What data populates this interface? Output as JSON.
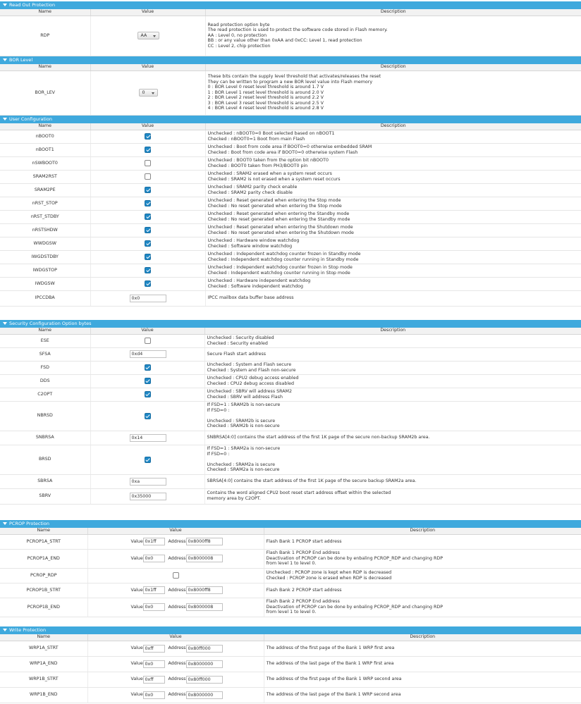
{
  "headers": {
    "name": "Name",
    "value": "Value",
    "description": "Description"
  },
  "value_label": "Value",
  "address_label": "Address",
  "sections": {
    "rop": {
      "title": "Read Out Protection",
      "rows": [
        {
          "name": "RDP",
          "select": "AA",
          "desc": [
            "Read protection option byte",
            "The read protection is used to protect the software code stored in Flash memory.",
            "AA : Level 0, no protection",
            "BB : or any value other than 0xAA and 0xCC: Level 1, read protection",
            "CC : Level 2, chip protection"
          ]
        }
      ]
    },
    "bor": {
      "title": "BOR Level",
      "rows": [
        {
          "name": "BOR_LEV",
          "select": "0",
          "desc": [
            "These bits contain the supply level threshold that activates/releases the reset",
            "They can be written to program a new BOR level value into Flash memory",
            "0 : BOR Level 0 reset level threshold is around 1.7 V",
            "1 : BOR Level 1 reset level threshold is around 2.0 V",
            "2 : BOR Level 2 reset level threshold is around 2.2 V",
            "3 : BOR Level 3 reset level threshold is around 2.5 V",
            "4 : BOR Level 4 reset level threshold is around 2.8 V"
          ]
        }
      ]
    },
    "user": {
      "title": "User Configuration",
      "rows": [
        {
          "name": "nBOOT0",
          "checked": true,
          "desc": [
            "Unchecked : nBOOT0=0 Boot selected based on nBOOT1",
            "Checked     : nBOOT0=1 Boot from main Flash"
          ]
        },
        {
          "name": "nBOOT1",
          "checked": true,
          "desc": [
            "Unchecked : Boot from code area if BOOT0=0 otherwise embedded SRAM",
            "Checked     : Boot from code area if BOOT0=0 otherwise system Flash"
          ]
        },
        {
          "name": "nSWBOOT0",
          "checked": false,
          "desc": [
            "Unchecked : BOOT0 taken from the option bit nBOOT0",
            "Checked     : BOOT0 taken from PH3/BOOT0 pin"
          ]
        },
        {
          "name": "SRAM2RST",
          "checked": false,
          "desc": [
            "Unchecked : SRAM2 erased when a system reset occurs",
            "Checked     : SRAM2 is not erased when a system reset occurs"
          ]
        },
        {
          "name": "SRAM2PE",
          "checked": true,
          "desc": [
            "Unchecked : SRAM2 parity check enable",
            "Checked     : SRAM2 parity check disable"
          ]
        },
        {
          "name": "nRST_STOP",
          "checked": true,
          "desc": [
            "Unchecked : Reset generated when entering the Stop mode",
            "Checked     : No reset generated when entering the Stop mode"
          ]
        },
        {
          "name": "nRST_STDBY",
          "checked": true,
          "desc": [
            "Unchecked : Reset generated when entering the Standby mode",
            "Checked     : No reset generated when entering the Standby mode"
          ]
        },
        {
          "name": "nRSTSHDW",
          "checked": true,
          "desc": [
            "Unchecked : Reset generated when entering the Shutdown mode",
            "Checked     : No reset generated when entering the Shutdown mode"
          ]
        },
        {
          "name": "WWDGSW",
          "checked": true,
          "desc": [
            "Unchecked : Hardware window watchdog",
            "Checked     : Software window watchdog"
          ]
        },
        {
          "name": "IWGDSTDBY",
          "checked": true,
          "desc": [
            "Unchecked : Independent watchdog counter frozen in Standby mode",
            "Checked     : Independent watchdog counter running in Standby mode"
          ]
        },
        {
          "name": "IWDGSTOP",
          "checked": true,
          "desc": [
            "Unchecked : Independent watchdog counter frozen in Stop mode",
            "Checked     : Independent watchdog counter running in Stop mode"
          ]
        },
        {
          "name": "IWDGSW",
          "checked": true,
          "desc": [
            "Unchecked : Hardware independent watchdog",
            "Checked     : Software independent watchdog"
          ]
        },
        {
          "name": "IPCCDBA",
          "input": "0x0",
          "desc": [
            "IPCC mailbox data buffer base address"
          ]
        }
      ]
    },
    "sec": {
      "title": "Security Configuration Option bytes",
      "rows": [
        {
          "name": "ESE",
          "checked": false,
          "desc": [
            "Unchecked : Security disabled",
            "Checked     : Security enabled"
          ]
        },
        {
          "name": "SFSA",
          "input": "0xd4",
          "desc": [
            "Secure Flash start address"
          ]
        },
        {
          "name": "FSD",
          "checked": true,
          "desc": [
            "Unchecked : System and Flash secure",
            "Checked     : System and Flash non-secure"
          ]
        },
        {
          "name": "DDS",
          "checked": true,
          "desc": [
            "Unchecked : CPU2 debug access enabled",
            "Checked     : CPU2 debug access disabled"
          ]
        },
        {
          "name": "C2OPT",
          "checked": true,
          "desc": [
            "Unchecked : SBRV will address SRAM2",
            "Checked     : SBRV will address Flash"
          ]
        },
        {
          "name": "NBRSD",
          "checked": true,
          "desc": [
            "If FSD=1 : SRAM2b is non-secure",
            "If FSD=0 :",
            "",
            "Unchecked : SRAM2b is secure",
            "Checked     : SRAM2b is non-secure"
          ]
        },
        {
          "name": "SNBRSA",
          "input": "0x14",
          "desc": [
            "SNBRSA[4:0] contains the start address of the first 1K page of the secure non-backup SRAM2b area."
          ]
        },
        {
          "name": "BRSD",
          "checked": true,
          "desc": [
            "If FSD=1 : SRAM2a is non-secure",
            "If FSD=0 :",
            "",
            "Unchecked : SRAM2a is secure",
            "Checked     : SRAM2a is non-secure"
          ]
        },
        {
          "name": "SBRSA",
          "input": "0xa",
          "desc": [
            "SBRSA[4:0] contains the start address of the first 1K page of the secure backup SRAM2a area."
          ]
        },
        {
          "name": "SBRV",
          "input": "0x35000",
          "desc": [
            "Contains the word aligned CPU2 boot reset start address offset within the selected",
            "memory area by C2OPT."
          ]
        }
      ]
    },
    "pcrop": {
      "title": "PCROP Protection",
      "rows": [
        {
          "name": "PCROP1A_STRT",
          "value": "0x1ff",
          "address": "0x8000ff8",
          "desc": [
            "Flash Bank 1 PCROP start address"
          ]
        },
        {
          "name": "PCROP1A_END",
          "value": "0x0",
          "address": "0x8000008",
          "desc": [
            "Flash Bank 1 PCROP End address",
            "Deactivation of PCROP can be done by enbaling PCROP_RDP and changing RDP",
            "from level 1 to level 0."
          ]
        },
        {
          "name": "PCROP_RDP",
          "checked": false,
          "desc": [
            "Unchecked : PCROP zone is kept when RDP is decreased",
            "Checked     : PCROP zone is erased when RDP is decreased"
          ]
        },
        {
          "name": "PCROP1B_STRT",
          "value": "0x1ff",
          "address": "0x8000ff8",
          "desc": [
            "Flash Bank 2 PCROP start address"
          ]
        },
        {
          "name": "PCROP1B_END",
          "value": "0x0",
          "address": "0x8000008",
          "desc": [
            "Flash Bank 2 PCROP End address",
            "Deactivation of PCROP can be done by enbaling PCROP_RDP and changing RDP",
            "from level 1 to level 0."
          ]
        }
      ]
    },
    "wrp": {
      "title": "Write Protection",
      "rows": [
        {
          "name": "WRP1A_STRT",
          "value": "0xff",
          "address": "0x80ff000",
          "desc": [
            "The address of the first page of the Bank 1 WRP first area"
          ]
        },
        {
          "name": "WRP1A_END",
          "value": "0x0",
          "address": "0x8000000",
          "desc": [
            "The address of the last page of the Bank 1 WRP first area"
          ]
        },
        {
          "name": "WRP1B_STRT",
          "value": "0xff",
          "address": "0x80ff000",
          "desc": [
            "The address of the first page of the Bank 1 WRP second area"
          ]
        },
        {
          "name": "WRP1B_END",
          "value": "0x0",
          "address": "0x8000000",
          "desc": [
            "The address of the last page of the Bank 1 WRP second area"
          ]
        }
      ]
    }
  }
}
